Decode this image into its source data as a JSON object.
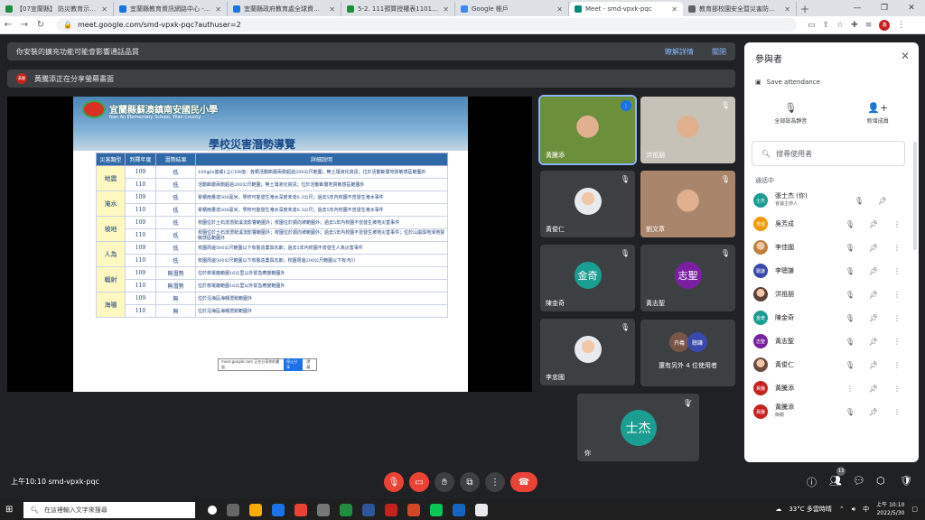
{
  "browser": {
    "tabs": [
      {
        "title": "【07宣蘭縣】 防災教育示範…",
        "color": "#1e8e3e",
        "active": false
      },
      {
        "title": "宜蘭縣教育資訊網路中心 - 教師…",
        "color": "#1a73e8",
        "active": false
      },
      {
        "title": "宜蘭縣政府教育處全球資訊網",
        "color": "#1a73e8",
        "active": false
      },
      {
        "title": "5-2. 111預算授權表1101122…",
        "color": "#1e8e3e",
        "active": false
      },
      {
        "title": "Google 帳戶",
        "color": "#4285f4",
        "active": false
      },
      {
        "title": "Meet - smd-vpxk-pqc",
        "color": "#00897b",
        "active": true
      },
      {
        "title": "教育部校園安全暨災害防救通報…",
        "color": "#5f6368",
        "active": false
      }
    ],
    "url": "meet.google.com/smd-vpxk-pqc?authuser=2",
    "profile_initial": "鑫"
  },
  "banners": {
    "extension_text": "你安裝的擴充功能可能會影響通話品質",
    "learn_more": "瞭解詳情",
    "dismiss": "關閉",
    "presenting_text": "黃騰添正在分享螢幕畫面",
    "presenter_badge": "黃騰"
  },
  "slide": {
    "school": "宜蘭縣蘇澳鎮南安國民小學",
    "school_en": "Nan An Elementary School, Yilan County",
    "title": "學校災害潛勢導覽",
    "headers": [
      "災害類型",
      "判釋年度",
      "潛勢結果",
      "詳細說明"
    ],
    "rows": [
      {
        "cat": "地震",
        "year": "109",
        "result": "低",
        "desc": "100≦Is值或1≦CDR值：各類活動斷層兩側超過200公尺範圍；無土壤液化資訊；位於活動斷層地質敏感區範圍外"
      },
      {
        "cat": "",
        "year": "110",
        "result": "低",
        "desc": "活動斷層兩側超過200公尺範圍；無土壤液化資訊；位於活動斷層地質敏感區範圍外"
      },
      {
        "cat": "淹水",
        "year": "109",
        "result": "低",
        "desc": "累積雨量達500毫米，學校可能發生淹水深度未達0.3公尺；過去5年內校園不曾發生淹水事件"
      },
      {
        "cat": "",
        "year": "110",
        "result": "低",
        "desc": "累積雨量達500毫米，學校可能發生淹水深度未達0.3公尺；過去5年內校園不曾發生淹水事件"
      },
      {
        "cat": "坡地",
        "year": "109",
        "result": "低",
        "desc": "校園位於土石流潛勢溪流影響範圍外；校園位於順向坡範圍外；過去5年內校園不曾發生坡地災害事件"
      },
      {
        "cat": "",
        "year": "110",
        "result": "低",
        "desc": "校園位於土石流潛勢溪流影響範圍外；校園位於順向坡範圍外；過去5年內校園不曾發生坡地災害事件；位於山崩與地滑地質敏感區範圍外"
      },
      {
        "cat": "人為",
        "year": "109",
        "result": "低",
        "desc": "校園周邊500公尺範圍以下有製造業與瓦斯；過去5年內校園不曾發生人為災害事件"
      },
      {
        "cat": "",
        "year": "110",
        "result": "低",
        "desc": "校園周邊500公尺範圍以下有製造業與瓦斯；校園周邊200公尺範圍以下有河川"
      },
      {
        "cat": "輻射",
        "year": "109",
        "result": "無潛勢",
        "desc": "位於核電廠範圍16公里以外緊急應變範圍外"
      },
      {
        "cat": "",
        "year": "110",
        "result": "無潛勢",
        "desc": "位於核電廠範圍16公里以外緊急應變範圍外"
      },
      {
        "cat": "海嘯",
        "year": "109",
        "result": "無",
        "desc": "位於沿海區海嘯潛勢範圍外"
      },
      {
        "cat": "",
        "year": "110",
        "result": "無",
        "desc": "位於沿海區海嘯潛勢範圍外"
      }
    ],
    "popup_text": "meet.google.com 正在分享你的畫面",
    "popup_stop": "停止分享",
    "popup_hide": "隱藏"
  },
  "tiles": [
    {
      "name": "黃騰添",
      "kind": "photo",
      "color": "#6b8f3a"
    },
    {
      "name": "洪祖朋",
      "kind": "photo",
      "color": "#c7c2b8"
    },
    {
      "name": "黃俊仁",
      "kind": "avatar",
      "color": "#e8eaed",
      "initial": ""
    },
    {
      "name": "劉文章",
      "kind": "photo",
      "color": "#a8856b"
    },
    {
      "name": "陳金奇",
      "kind": "avatar",
      "color": "#1a9e91",
      "initial": "金奇"
    },
    {
      "name": "黃志聖",
      "kind": "avatar",
      "color": "#7b1fa2",
      "initial": "志聖"
    },
    {
      "name": "李忠國",
      "kind": "avatar",
      "color": "#e8eaed",
      "initial": ""
    }
  ],
  "more_tile": {
    "text": "還有另外 4 位使用者",
    "a1": "卉羲",
    "a2": "聰謙"
  },
  "self_tile": {
    "name": "你",
    "initial": "士杰"
  },
  "panel": {
    "title": "參與者",
    "save_attendance": "Save attendance",
    "mute_all": "全部設為靜音",
    "add_people": "新增成員",
    "search_placeholder": "搜尋使用者",
    "section": "通話中",
    "participants": [
      {
        "name": "張士杰 (你)",
        "sub": "會議主辦人",
        "initial": "士杰",
        "color": "#1a9e91"
      },
      {
        "name": "吳芳成",
        "sub": "",
        "initial": "芳成",
        "color": "#f29900"
      },
      {
        "name": "李佳國",
        "sub": "",
        "initial": "",
        "color": "#c0803a"
      },
      {
        "name": "李聰謙",
        "sub": "",
        "initial": "聰謙",
        "color": "#3949ab"
      },
      {
        "name": "洪祖朋",
        "sub": "",
        "initial": "",
        "color": "#5d4037"
      },
      {
        "name": "陳金奇",
        "sub": "",
        "initial": "金奇",
        "color": "#1a9e91"
      },
      {
        "name": "黃志聖",
        "sub": "",
        "initial": "志聖",
        "color": "#7b1fa2"
      },
      {
        "name": "黃俊仁",
        "sub": "",
        "initial": "",
        "color": "#6d4c41"
      },
      {
        "name": "黃騰添",
        "sub": "",
        "initial": "黃騰",
        "color": "#c5221f"
      },
      {
        "name": "黃騰添",
        "sub": "簡報",
        "initial": "黃騰",
        "color": "#c5221f"
      }
    ]
  },
  "bottom": {
    "time_code": "上午10:10  smd-vpxk-pqc",
    "people_count": "13"
  },
  "taskbar": {
    "search": "在這裡輸入文字來搜尋",
    "weather": "33°C 多雲時晴",
    "lang": "中",
    "time": "上午 10:10",
    "date": "2022/5/30"
  }
}
